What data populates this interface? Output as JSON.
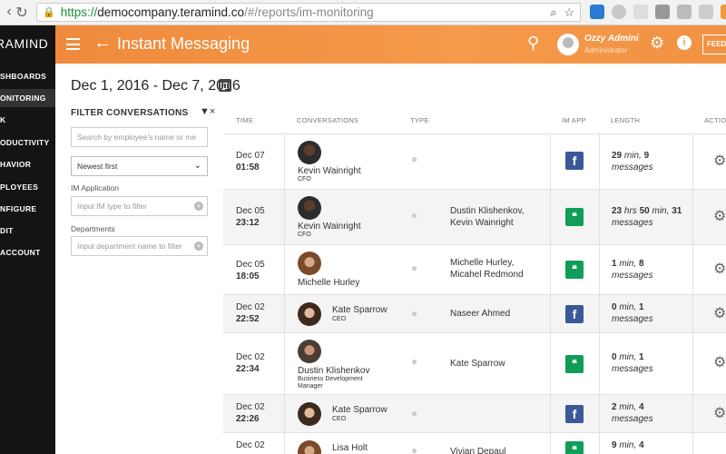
{
  "browser": {
    "url_https": "https://",
    "url_host": "democompany.teramind.co",
    "url_path": "/#/reports/im-monitoring"
  },
  "nav": {
    "brand": "RAMIND",
    "items": [
      "SHBOARDS",
      "ONITORING",
      "K",
      "ODUCTIVITY",
      "HAVIOR",
      "PLOYEES",
      "NFIGURE",
      "DIT",
      "ACCOUNT"
    ]
  },
  "header": {
    "title": "Instant Messaging",
    "user_name": "Ozzy Admini",
    "user_role": "Administrator",
    "feed_label": "FEED"
  },
  "date_range": "Dec 1, 2016 - Dec 7, 2016",
  "filters": {
    "title": "FILTER CONVERSATIONS",
    "search_placeholder": "Search by employee's name or me",
    "sort_value": "Newest first",
    "im_label": "IM Application",
    "im_placeholder": "Input IM type to filter",
    "dept_label": "Departments",
    "dept_placeholder": "Input department name to filter"
  },
  "table": {
    "headers": [
      "TIME",
      "CONVERSATIONS",
      "TYPE",
      "IM APP",
      "LENGTH",
      "ACTIO"
    ],
    "rows": [
      {
        "date": "Dec 07",
        "time": "01:58",
        "name": "Kevin Wainright",
        "title": "CFO",
        "partners": [
          "",
          ""
        ],
        "app": "f",
        "len_a": "29",
        "len_a_unit": "min,",
        "len_b": "9",
        "len_b_unit": "messages"
      },
      {
        "date": "Dec 05",
        "time": "23:12",
        "name": "Kevin Wainright",
        "title": "CFO",
        "partners": [
          "Dustin Klishenkov,",
          "Kevin Wainright"
        ],
        "app": "hangouts",
        "len_a": "23",
        "len_a_unit": "hrs",
        "len_a2": "50",
        "len_a2_unit": "min,",
        "len_b": "31",
        "len_b_unit": "messages"
      },
      {
        "date": "Dec 05",
        "time": "18:05",
        "name": "Michelle Hurley",
        "title": "",
        "partners": [
          "Michelle Hurley,",
          "Micahel Redmond"
        ],
        "app": "hangouts",
        "len_a": "1",
        "len_a_unit": "min,",
        "len_b": "8",
        "len_b_unit": "messages"
      },
      {
        "date": "Dec 02",
        "time": "22:52",
        "name": "Kate Sparrow",
        "title": "CEO",
        "partners": [
          "Naseer Ahmed",
          ""
        ],
        "app": "f",
        "len_a": "0",
        "len_a_unit": "min,",
        "len_b": "1",
        "len_b_unit": "messages"
      },
      {
        "date": "Dec 02",
        "time": "22:34",
        "name": "Dustin Klishenkov",
        "title": "Business Development Manager",
        "partners": [
          "Kate Sparrow",
          ""
        ],
        "app": "hangouts",
        "len_a": "0",
        "len_a_unit": "min,",
        "len_b": "1",
        "len_b_unit": "messages"
      },
      {
        "date": "Dec 02",
        "time": "22:26",
        "name": "Kate Sparrow",
        "title": "CEO",
        "partners": [
          "",
          ""
        ],
        "app": "f",
        "len_a": "2",
        "len_a_unit": "min,",
        "len_b": "4",
        "len_b_unit": "messages"
      },
      {
        "date": "Dec 02",
        "time": "",
        "name": "Lisa Holt",
        "title": "",
        "partners": [
          "Vivian Depaul",
          ""
        ],
        "app": "hangouts",
        "len_a": "9",
        "len_a_unit": "min,",
        "len_b": "4",
        "len_b_unit": ""
      }
    ]
  },
  "colors": {
    "header_orange": "#f08a3c",
    "facebook": "#3b5998",
    "hangouts": "#0f9d58"
  }
}
